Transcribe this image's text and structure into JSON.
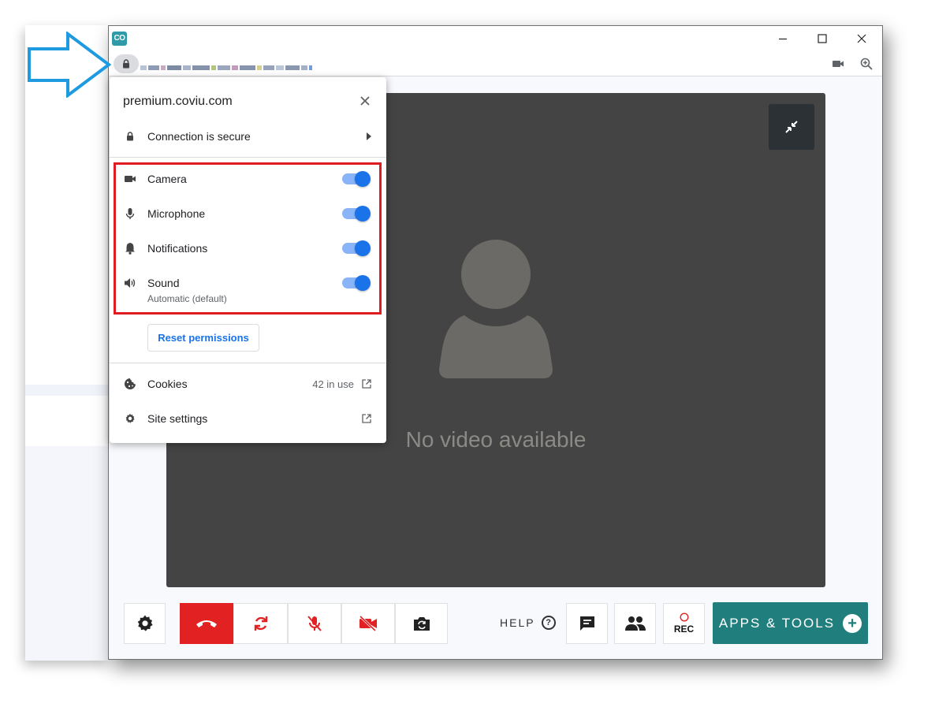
{
  "window": {
    "app_logo": "CO",
    "controls": [
      "minimize-icon",
      "maximize-icon",
      "close-icon"
    ]
  },
  "addressbar": {
    "icons": [
      "lock-icon",
      "camera-icon",
      "zoom-icon"
    ]
  },
  "popup": {
    "site": "premium.coviu.com",
    "connection": "Connection is secure",
    "permissions": [
      {
        "label": "Camera",
        "icon": "camera-icon",
        "enabled": true
      },
      {
        "label": "Microphone",
        "icon": "microphone-icon",
        "enabled": true
      },
      {
        "label": "Notifications",
        "icon": "bell-icon",
        "enabled": true
      },
      {
        "label": "Sound",
        "icon": "speaker-icon",
        "enabled": true,
        "sub": "Automatic (default)"
      }
    ],
    "reset_label": "Reset permissions",
    "cookies_label": "Cookies",
    "cookies_value": "42 in use",
    "site_settings_label": "Site settings"
  },
  "video": {
    "message": "No video available"
  },
  "toolbar": {
    "help_label": "HELP",
    "help_glyph": "?",
    "rec_label": "REC",
    "apps_label": "APPS & TOOLS",
    "apps_plus": "+"
  },
  "colors": {
    "highlight": "#e01b22",
    "callout": "#1e9be0",
    "toggle": "#1a73e8",
    "hangup": "#e22222",
    "apps": "#207f7d"
  }
}
